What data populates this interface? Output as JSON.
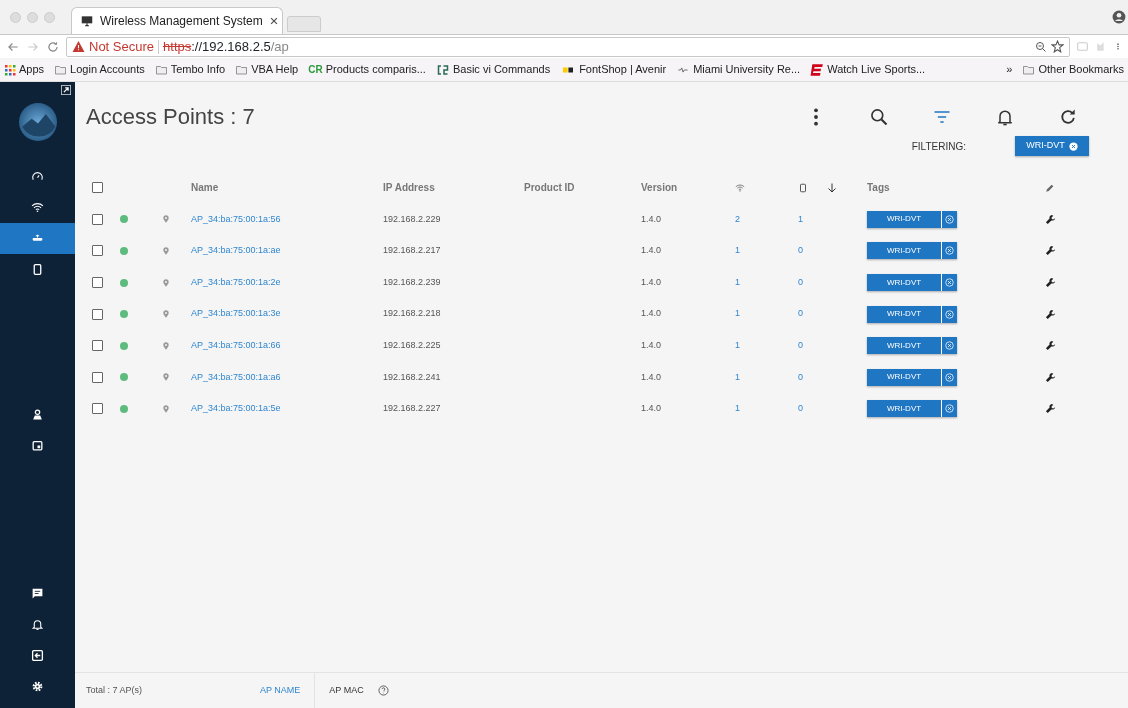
{
  "browser": {
    "tab_title": "Wireless Management System",
    "url": {
      "warning": "Not Secure",
      "scheme": "https",
      "host": "://192.168.2.5",
      "path": "/ap"
    },
    "bookmarks": [
      {
        "kind": "apps",
        "label": "Apps"
      },
      {
        "kind": "folder",
        "label": "Login Accounts"
      },
      {
        "kind": "folder",
        "label": "Tembo Info"
      },
      {
        "kind": "folder",
        "label": "VBA Help"
      },
      {
        "kind": "letters",
        "badge": "CR",
        "label": "Products comparis..."
      },
      {
        "kind": "cs",
        "label": "Basic vi Commands"
      },
      {
        "kind": "fontshop",
        "label": "FontShop | Avenir"
      },
      {
        "kind": "miami",
        "label": "Miami University Re..."
      },
      {
        "kind": "espn",
        "label": "Watch Live Sports..."
      }
    ],
    "more": "»",
    "other": "Other Bookmarks"
  },
  "sidebar": {
    "top": [
      {
        "kind": "gauge",
        "selected": false
      },
      {
        "kind": "wifi",
        "selected": false
      },
      {
        "kind": "router",
        "selected": true
      },
      {
        "kind": "phone",
        "selected": false
      }
    ],
    "middle": [
      {
        "kind": "userpin",
        "selected": false
      },
      {
        "kind": "calendar",
        "selected": false
      }
    ],
    "bottom": [
      {
        "kind": "chat",
        "selected": false
      },
      {
        "kind": "bell",
        "selected": false
      },
      {
        "kind": "logout",
        "selected": false
      },
      {
        "kind": "gear",
        "selected": false
      }
    ]
  },
  "header": {
    "title": "Access Points : 7",
    "tools": [
      {
        "kind": "more",
        "active": false
      },
      {
        "kind": "search",
        "active": false
      },
      {
        "kind": "filter",
        "active": true
      },
      {
        "kind": "bell",
        "active": false
      },
      {
        "kind": "refresh",
        "active": false
      }
    ],
    "filter_label": "FILTERING:",
    "filter_chip": "WRI-DVT"
  },
  "table": {
    "select_all_checked": false,
    "columns": [
      "Name",
      "IP Address",
      "Product ID",
      "Version",
      "Tags"
    ],
    "rows": [
      {
        "checked": false,
        "color": "#5dbb7d",
        "name": "AP_34:ba:75:00:1a:56",
        "ip": "192.168.2.229",
        "version": "1.4.0",
        "radios": "2",
        "clients": "1",
        "tag": "WRI-DVT"
      },
      {
        "checked": false,
        "color": "#5dbb7d",
        "name": "AP_34:ba:75:00:1a:ae",
        "ip": "192.168.2.217",
        "version": "1.4.0",
        "radios": "1",
        "clients": "0",
        "tag": "WRI-DVT"
      },
      {
        "checked": false,
        "color": "#5dbb7d",
        "name": "AP_34:ba:75:00:1a:2e",
        "ip": "192.168.2.239",
        "version": "1.4.0",
        "radios": "1",
        "clients": "0",
        "tag": "WRI-DVT"
      },
      {
        "checked": false,
        "color": "#5dbb7d",
        "name": "AP_34:ba:75:00:1a:3e",
        "ip": "192.168.2.218",
        "version": "1.4.0",
        "radios": "1",
        "clients": "0",
        "tag": "WRI-DVT"
      },
      {
        "checked": false,
        "color": "#5dbb7d",
        "name": "AP_34:ba:75:00:1a:66",
        "ip": "192.168.2.225",
        "version": "1.4.0",
        "radios": "1",
        "clients": "0",
        "tag": "WRI-DVT"
      },
      {
        "checked": false,
        "color": "#5dbb7d",
        "name": "AP_34:ba:75:00:1a:a6",
        "ip": "192.168.2.241",
        "version": "1.4.0",
        "radios": "1",
        "clients": "0",
        "tag": "WRI-DVT"
      },
      {
        "checked": false,
        "color": "#5dbb7d",
        "name": "AP_34:ba:75:00:1a:5e",
        "ip": "192.168.2.227",
        "version": "1.4.0",
        "radios": "1",
        "clients": "0",
        "tag": "WRI-DVT"
      }
    ]
  },
  "footer": {
    "total": "Total : 7 AP(s)",
    "tabs": [
      {
        "label": "AP NAME",
        "selected": true
      },
      {
        "label": "AP MAC",
        "selected": false
      }
    ]
  }
}
